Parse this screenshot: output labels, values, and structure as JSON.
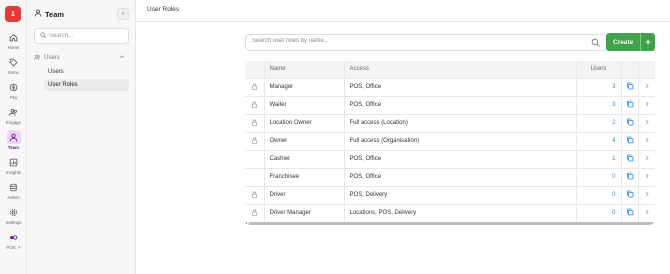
{
  "app": {
    "logo_text": "1",
    "accent": "#e53935"
  },
  "rail": [
    {
      "label": "Home",
      "icon": "home-icon"
    },
    {
      "label": "Items",
      "icon": "tag-icon"
    },
    {
      "label": "Pay",
      "icon": "dollar-icon"
    },
    {
      "label": "Engage",
      "icon": "people-icon"
    },
    {
      "label": "Team",
      "icon": "person-icon",
      "active": true
    },
    {
      "label": "Insights",
      "icon": "chart-icon"
    },
    {
      "label": "Admin",
      "icon": "database-icon"
    },
    {
      "label": "Settings",
      "icon": "gear-icon"
    },
    {
      "label": "POS ↗",
      "icon": "pos-icon"
    }
  ],
  "sidebar": {
    "title": "Team",
    "collapse_label": "«",
    "search_placeholder": "Search...",
    "group_label": "Users",
    "items": [
      {
        "label": "Users"
      },
      {
        "label": "User Roles",
        "active": true
      }
    ]
  },
  "header": {
    "breadcrumb": "User Roles"
  },
  "search": {
    "placeholder": "Search user roles by name..."
  },
  "create_button": {
    "label": "Create",
    "plus": "+"
  },
  "table": {
    "headers": {
      "name": "Name",
      "access": "Access",
      "users": "Users"
    },
    "rows": [
      {
        "locked": true,
        "name": "Manager",
        "access": "POS, Office",
        "users": "3"
      },
      {
        "locked": true,
        "name": "Waiter",
        "access": "POS, Office",
        "users": "3"
      },
      {
        "locked": true,
        "name": "Location Owner",
        "access": "Full access (Location)",
        "users": "2"
      },
      {
        "locked": true,
        "name": "Owner",
        "access": "Full access (Organisation)",
        "users": "4"
      },
      {
        "locked": false,
        "name": "Cashier",
        "access": "POS, Office",
        "users": "1"
      },
      {
        "locked": false,
        "name": "Franchisee",
        "access": "POS, Office",
        "users": "0"
      },
      {
        "locked": true,
        "name": "Driver",
        "access": "POS, Delivery",
        "users": "0"
      },
      {
        "locked": true,
        "name": "Driver Manager",
        "access": "Locations, POS, Delivery",
        "users": "0"
      }
    ]
  },
  "colors": {
    "create_green": "#3ea447",
    "link_blue": "#1e88e5",
    "active_purple": "#6a1b9a"
  }
}
